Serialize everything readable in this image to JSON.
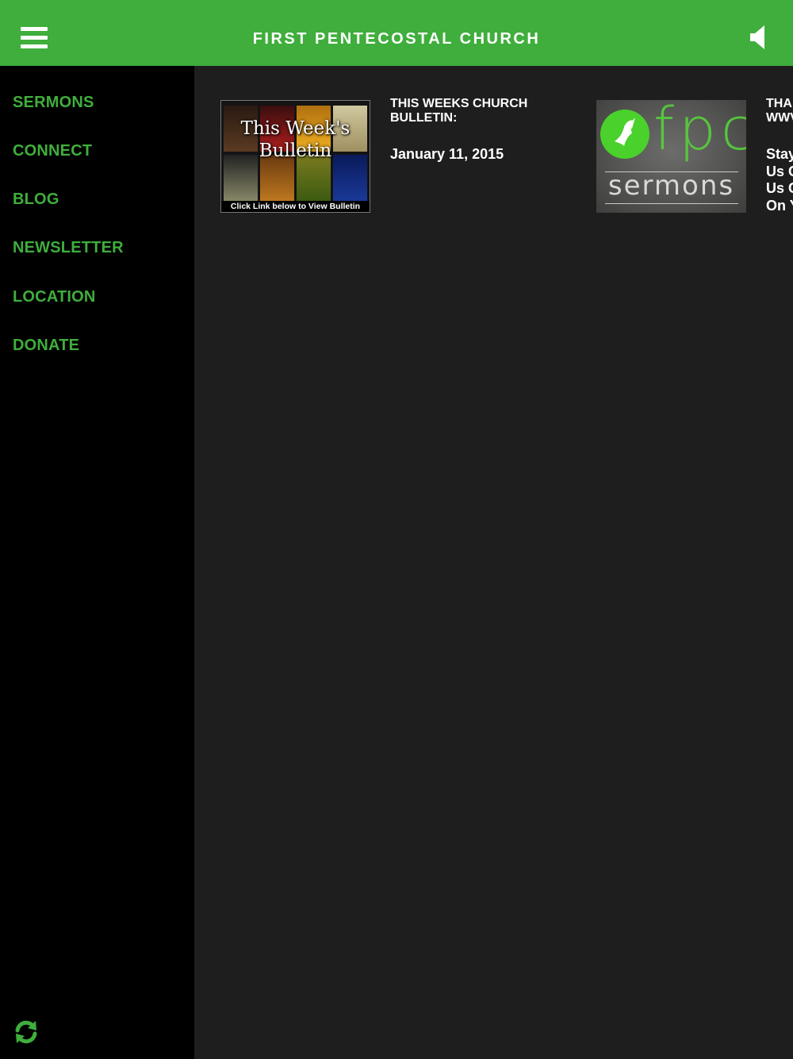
{
  "header": {
    "title": "FIRST PENTECOSTAL CHURCH",
    "accent_color": "#3fae3c",
    "menu_icon": "hamburger-menu-icon",
    "speaker_icon": "speaker-icon"
  },
  "sidebar": {
    "items": [
      {
        "label": "SERMONS"
      },
      {
        "label": "CONNECT"
      },
      {
        "label": "BLOG"
      },
      {
        "label": "NEWSLETTER"
      },
      {
        "label": "LOCATION"
      },
      {
        "label": "DONATE"
      }
    ],
    "refresh_icon": "refresh-icon"
  },
  "cards": [
    {
      "title": "THIS WEEKS CHURCH BULLETIN:",
      "body": "January 11, 2015",
      "image": {
        "heading_line1": "This Week's",
        "heading_line2": "Bulletin",
        "caption": "Click Link below to View Bulletin"
      }
    },
    {
      "title_line1": "THA",
      "title_line2": "WWV",
      "body_lines": [
        "Stay",
        "Us C",
        "Us C",
        "On Y"
      ],
      "image": {
        "logo_text": "fpc",
        "subtitle": "sermons"
      }
    }
  ]
}
